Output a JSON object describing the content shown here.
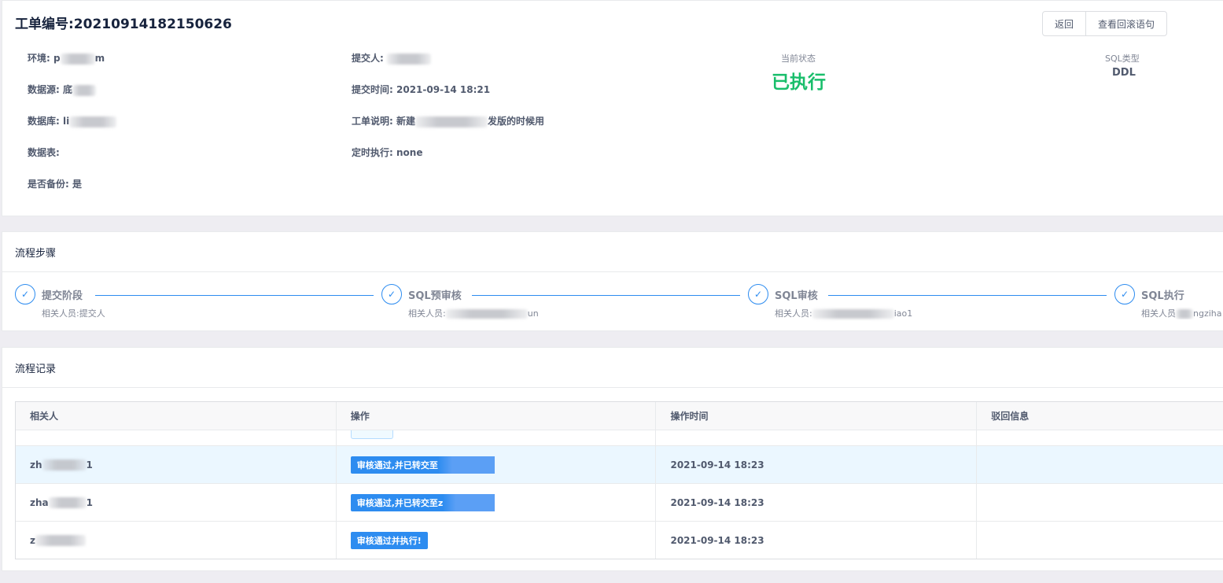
{
  "order": {
    "title": "工单编号:20210914182150626",
    "buttons": {
      "back": "返回",
      "rollback": "查看回滚语句"
    },
    "fields": {
      "env_label": "环境:",
      "env_value_prefix": "p",
      "env_value_suffix": "m",
      "datasource_label": "数据源:",
      "datasource_value_prefix": "底",
      "database_label": "数据库:",
      "database_value_prefix": "li",
      "table_label": "数据表:",
      "backup_label": "是否备份:",
      "backup_value": "是",
      "submitter_label": "提交人:",
      "submit_time_label": "提交时间:",
      "submit_time_value": "2021-09-14 18:21",
      "desc_label": "工单说明:",
      "desc_value_prefix": "新建",
      "desc_value_suffix": "发版的时候用",
      "schedule_label": "定时执行:",
      "schedule_value": "none"
    },
    "status_label": "当前状态",
    "status_value": "已执行",
    "status_color": "#19be6b",
    "sqltype_label": "SQL类型",
    "sqltype_value": "DDL"
  },
  "steps": {
    "title": "流程步骤",
    "items": [
      {
        "title": "提交阶段",
        "desc_prefix": "相关人员:提交人",
        "desc_suffix": "",
        "icon": "check-icon"
      },
      {
        "title": "SQL预审核",
        "desc_prefix": "相关人员:",
        "desc_suffix": "un",
        "icon": "check-icon"
      },
      {
        "title": "SQL审核",
        "desc_prefix": "相关人员:",
        "desc_suffix": "iao1",
        "icon": "check-icon"
      },
      {
        "title": "SQL执行",
        "desc_prefix": "相关人员",
        "desc_suffix": "ngziha",
        "icon": "check-icon"
      }
    ],
    "accent_color": "#2d8cf0"
  },
  "records": {
    "title": "流程记录",
    "columns": [
      "相关人",
      "操作",
      "操作时间",
      "驳回信息"
    ],
    "rows": [
      {
        "user_prefix": "zh",
        "user_suffix": "1",
        "action": "审核通过,并已转交至",
        "time": "2021-09-14 18:23",
        "reject": ""
      },
      {
        "user_prefix": "zha",
        "user_suffix": "1",
        "action": "审核通过,并已转交至z",
        "time": "2021-09-14 18:23",
        "reject": ""
      },
      {
        "user_prefix": "z",
        "user_suffix": "",
        "action": "审核通过并执行!",
        "time": "2021-09-14 18:23",
        "reject": ""
      }
    ],
    "tag_color": "#2d8cf0"
  }
}
